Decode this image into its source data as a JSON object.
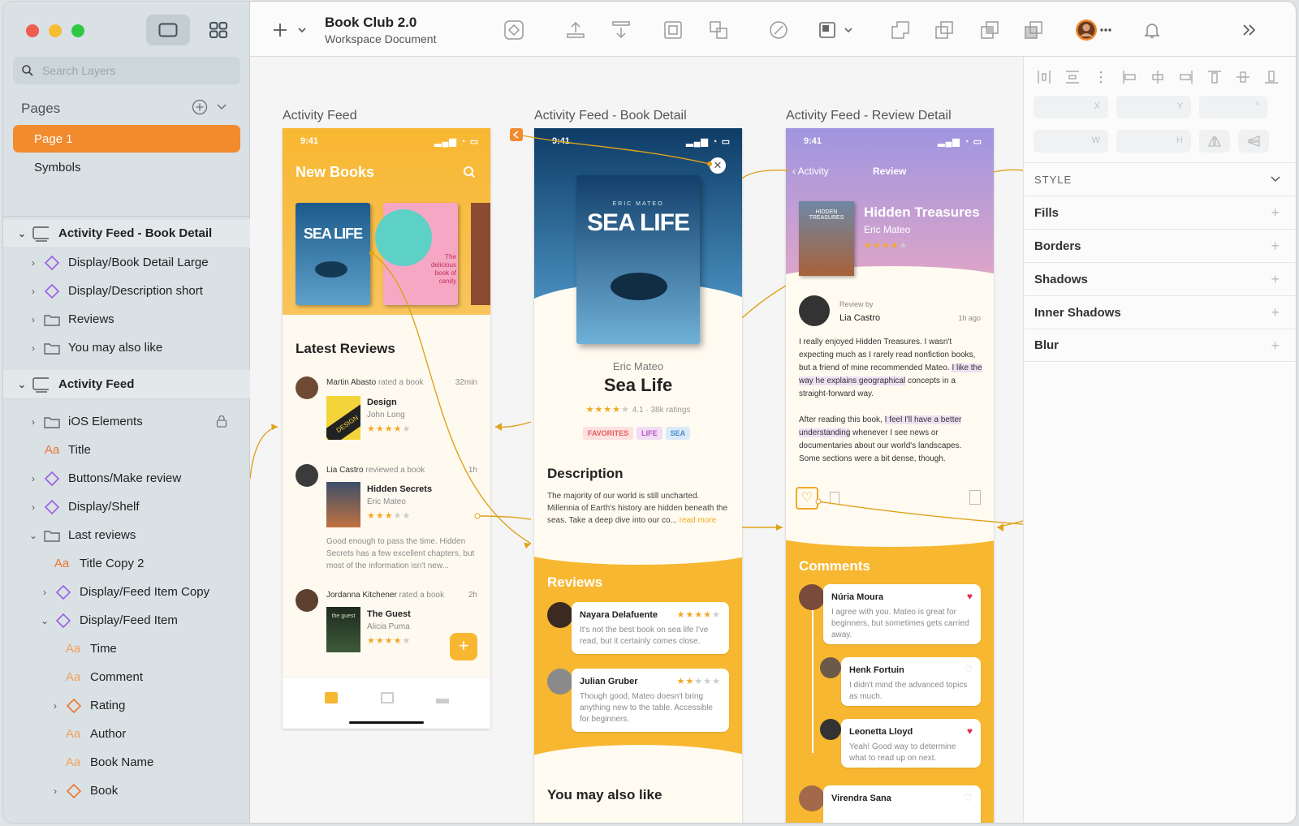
{
  "window": {
    "title": "Book Club 2.0",
    "subtitle": "Workspace Document"
  },
  "sidebar": {
    "search_placeholder": "Search Layers",
    "pages_label": "Pages",
    "pages": [
      "Page 1",
      "Symbols"
    ],
    "layers": [
      {
        "label": "Activity Feed - Book Detail",
        "icon": "artboard-icon",
        "group": true
      },
      {
        "label": "Display/Book Detail Large",
        "icon": "symbol-icon"
      },
      {
        "label": "Display/Description short",
        "icon": "symbol-icon"
      },
      {
        "label": "Reviews",
        "icon": "folder-icon"
      },
      {
        "label": "You may also like",
        "icon": "folder-icon"
      },
      {
        "label": "Activity Feed",
        "icon": "artboard-icon",
        "group": true
      },
      {
        "label": "iOS Elements",
        "icon": "folder-icon"
      },
      {
        "label": "Title",
        "icon": "text-icon"
      },
      {
        "label": "Buttons/Make review",
        "icon": "symbol-icon"
      },
      {
        "label": "Display/Shelf",
        "icon": "symbol-icon"
      },
      {
        "label": "Last reviews",
        "icon": "folder-icon"
      },
      {
        "label": "Title Copy 2",
        "icon": "text-icon"
      },
      {
        "label": "Display/Feed Item Copy",
        "icon": "symbol-icon"
      },
      {
        "label": "Display/Feed Item",
        "icon": "symbol-icon"
      },
      {
        "label": "Time",
        "icon": "text-icon"
      },
      {
        "label": "Comment",
        "icon": "text-icon"
      },
      {
        "label": "Rating",
        "icon": "symbol-icon"
      },
      {
        "label": "Author",
        "icon": "text-icon"
      },
      {
        "label": "Book Name",
        "icon": "text-icon"
      },
      {
        "label": "Book",
        "icon": "symbol-icon"
      }
    ]
  },
  "inspector": {
    "fields": [
      "X",
      "Y",
      "°",
      "W",
      "H"
    ],
    "style_label": "STYLE",
    "sections": [
      "Fills",
      "Borders",
      "Shadows",
      "Inner Shadows",
      "Blur"
    ]
  },
  "artboards": {
    "feed": {
      "title": "Activity Feed",
      "time": "9:41",
      "header": "New Books",
      "cover1": "SEA LIFE",
      "cover2": "The delicious book of candy",
      "latest": "Latest Reviews",
      "items": [
        {
          "user": "Martin Abasto",
          "action": "rated a book",
          "time": "32min",
          "book": "Design",
          "author": "John Long",
          "cover": "DESIGN"
        },
        {
          "user": "Lia Castro",
          "action": "reviewed a book",
          "time": "1h",
          "book": "Hidden Secrets",
          "author": "Eric Mateo",
          "comment": "Good enough to pass the time. Hidden Secrets has a few excellent chapters, but most of the information isn't new..."
        },
        {
          "user": "Jordanna Kitchener",
          "action": "rated a book",
          "time": "2h",
          "book": "The Guest",
          "author": "Alicia Puma",
          "cover": "the guest"
        }
      ]
    },
    "detail": {
      "title": "Activity Feed - Book Detail",
      "time": "9:41",
      "cover_author": "ERIC MATEO",
      "cover_title": "SEA LIFE",
      "author": "Eric Mateo",
      "book": "Sea Life",
      "rating": "4.1 · 38k ratings",
      "tags": [
        "FAVORITES",
        "LIFE",
        "SEA"
      ],
      "desc_h": "Description",
      "desc": "The majority of our world is still uncharted. Millennia of Earth's history are hidden beneath the seas. Take a deep dive into our co...",
      "read_more": "read more",
      "reviews_h": "Reviews",
      "reviews": [
        {
          "name": "Nayara Delafuente",
          "text": "It's not the best book on sea life I've read, but it certainly comes close."
        },
        {
          "name": "Julian Gruber",
          "text": "Though good, Mateo doesn't bring anything new to the table. Accessible for beginners."
        }
      ],
      "also": "You may also like"
    },
    "review": {
      "title": "Activity Feed - Review Detail",
      "time": "9:41",
      "back": "Activity",
      "nav": "Review",
      "cover": "HIDDEN TREASURES",
      "book": "Hidden Treasures",
      "author": "Eric Mateo",
      "review_by": "Review by",
      "reviewer": "Lia Castro",
      "ago": "1h ago",
      "p1a": "I really enjoyed Hidden Treasures. I wasn't expecting much as I rarely read nonfiction books, but a friend of mine recommended Mateo.",
      "p1b": "I like the way he explains geographical",
      "p1c": "concepts in a straight-forward way.",
      "p2a": "After reading this book,",
      "p2b": "I feel I'll have a better understanding",
      "p2c": "whenever I see news or documentaries about our world's landscapes. Some sections were a bit dense, though.",
      "comments_h": "Comments",
      "comments": [
        {
          "name": "Núria Moura",
          "text": "I agree with you. Mateo is great for beginners, but sometimes gets carried away."
        },
        {
          "name": "Henk Fortuin",
          "text": "I didn't mind the advanced topics as much."
        },
        {
          "name": "Leonetta Lloyd",
          "text": "Yeah! Good way to determine what to read up on next."
        },
        {
          "name": "Virendra Sana",
          "text": ""
        }
      ]
    }
  },
  "colors": {
    "accent": "#f28a2e",
    "app_yellow": "#f8b731",
    "prototype_link": "#e0a21a"
  }
}
